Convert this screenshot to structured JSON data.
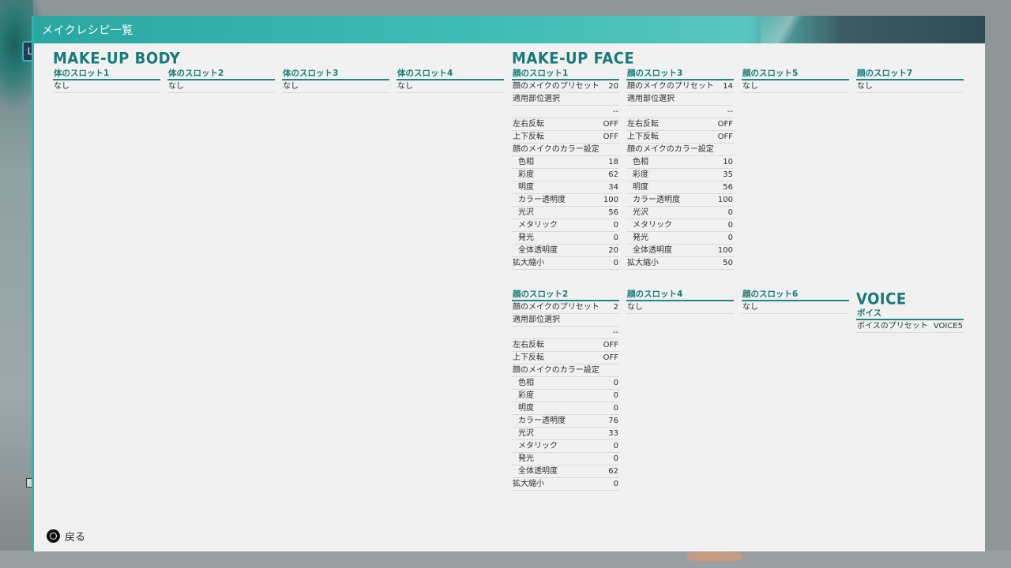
{
  "window": {
    "title": "メイクレシピ一覧",
    "side_tag": "L"
  },
  "body": {
    "title": "MAKE-UP BODY",
    "slots": [
      {
        "label": "体のスロット1",
        "value": "なし"
      },
      {
        "label": "体のスロット2",
        "value": "なし"
      },
      {
        "label": "体のスロット3",
        "value": "なし"
      },
      {
        "label": "体のスロット4",
        "value": "なし"
      }
    ]
  },
  "face": {
    "title": "MAKE-UP FACE",
    "slot1": {
      "label": "顔のスロット1",
      "rows": [
        {
          "lbl": "顔のメイクのプリセット",
          "val": "20"
        },
        {
          "lbl": "適用部位選択",
          "val": ""
        },
        {
          "lbl": "",
          "val": "--"
        },
        {
          "lbl": "左右反転",
          "val": "OFF"
        },
        {
          "lbl": "上下反転",
          "val": "OFF"
        },
        {
          "lbl": "顔のメイクのカラー設定",
          "val": ""
        },
        {
          "lbl": "色相",
          "val": "18"
        },
        {
          "lbl": "彩度",
          "val": "62"
        },
        {
          "lbl": "明度",
          "val": "34"
        },
        {
          "lbl": "カラー透明度",
          "val": "100"
        },
        {
          "lbl": "光沢",
          "val": "56"
        },
        {
          "lbl": "メタリック",
          "val": "0"
        },
        {
          "lbl": "発光",
          "val": "0"
        },
        {
          "lbl": "全体透明度",
          "val": "20"
        },
        {
          "lbl": "拡大縮小",
          "val": "0"
        }
      ]
    },
    "slot2": {
      "label": "顔のスロット2",
      "rows": [
        {
          "lbl": "顔のメイクのプリセット",
          "val": "2"
        },
        {
          "lbl": "適用部位選択",
          "val": ""
        },
        {
          "lbl": "",
          "val": "--"
        },
        {
          "lbl": "左右反転",
          "val": "OFF"
        },
        {
          "lbl": "上下反転",
          "val": "OFF"
        },
        {
          "lbl": "顔のメイクのカラー設定",
          "val": ""
        },
        {
          "lbl": "色相",
          "val": "0"
        },
        {
          "lbl": "彩度",
          "val": "0"
        },
        {
          "lbl": "明度",
          "val": "0"
        },
        {
          "lbl": "カラー透明度",
          "val": "76"
        },
        {
          "lbl": "光沢",
          "val": "33"
        },
        {
          "lbl": "メタリック",
          "val": "0"
        },
        {
          "lbl": "発光",
          "val": "0"
        },
        {
          "lbl": "全体透明度",
          "val": "62"
        },
        {
          "lbl": "拡大縮小",
          "val": "0"
        }
      ]
    },
    "slot3": {
      "label": "顔のスロット3",
      "rows": [
        {
          "lbl": "顔のメイクのプリセット",
          "val": "14"
        },
        {
          "lbl": "適用部位選択",
          "val": ""
        },
        {
          "lbl": "",
          "val": "--"
        },
        {
          "lbl": "左右反転",
          "val": "OFF"
        },
        {
          "lbl": "上下反転",
          "val": "OFF"
        },
        {
          "lbl": "顔のメイクのカラー設定",
          "val": ""
        },
        {
          "lbl": "色相",
          "val": "10"
        },
        {
          "lbl": "彩度",
          "val": "35"
        },
        {
          "lbl": "明度",
          "val": "56"
        },
        {
          "lbl": "カラー透明度",
          "val": "100"
        },
        {
          "lbl": "光沢",
          "val": "0"
        },
        {
          "lbl": "メタリック",
          "val": "0"
        },
        {
          "lbl": "発光",
          "val": "0"
        },
        {
          "lbl": "全体透明度",
          "val": "100"
        },
        {
          "lbl": "拡大縮小",
          "val": "50"
        }
      ]
    },
    "slot4": {
      "label": "顔のスロット4",
      "value": "なし"
    },
    "slot5": {
      "label": "顔のスロット5",
      "value": "なし"
    },
    "slot6": {
      "label": "顔のスロット6",
      "value": "なし"
    },
    "slot7": {
      "label": "顔のスロット7",
      "value": "なし"
    }
  },
  "voice": {
    "title": "VOICE",
    "head": "ボイス",
    "preset_label": "ボイスのプリセット",
    "preset_value": "VOICE5"
  },
  "footer": {
    "back_label": "戻る"
  },
  "colors": {
    "accent": "#2fb5ad",
    "heading": "#177a78",
    "panel": "#f1f1f1"
  }
}
